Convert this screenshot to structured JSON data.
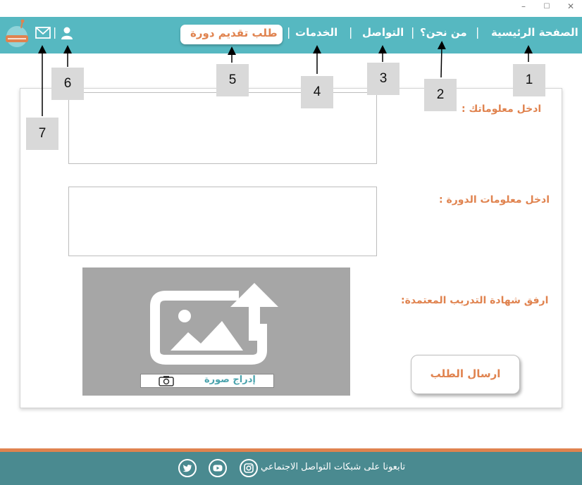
{
  "window": {
    "minimize_glyph": "–",
    "maximize_glyph": "☐",
    "close_glyph": "✕"
  },
  "nav": {
    "home": "الصفحة الرئيسية",
    "about": "من نحن؟",
    "contact": "التواصل",
    "services": "الخدمات",
    "course_request": "طلب تقديم دورة",
    "separator": "|",
    "icons": [
      "user-icon",
      "mail-icon",
      "logo"
    ]
  },
  "annotations": [
    "1",
    "2",
    "3",
    "4",
    "5",
    "6",
    "7"
  ],
  "form": {
    "info_label": "ادخل معلوماتك :",
    "course_label": "ادخل معلومات الدورة :",
    "certificate_label": "ارفق شهادة التدريب المعتمدة:",
    "insert_image": "إدراج صورة",
    "submit": "ارسال الطلب",
    "info_value": "",
    "course_value": ""
  },
  "footer": {
    "follow_text": "تابعونا على شبكات التواصل الاجتماعي",
    "social_icons": [
      "instagram-icon",
      "youtube-icon",
      "twitter-icon"
    ]
  },
  "colors": {
    "nav_bg": "#56b8c1",
    "accent_orange": "#e0834f",
    "footer_bg": "#4a8a90",
    "upload_bg": "#a6a6a6"
  }
}
